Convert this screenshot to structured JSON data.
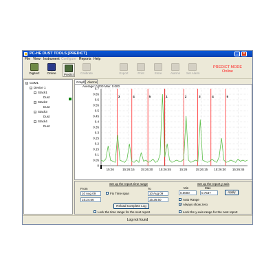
{
  "window": {
    "title": "PC-HE DUST TOOLS [PREDICT]"
  },
  "menu": [
    "File",
    "View",
    "Instrument",
    "Configure",
    "Reports",
    "Help"
  ],
  "toolbar": {
    "buttons": [
      {
        "label": "Digitect",
        "icon": "digitect-icon",
        "enabled": true,
        "color": "#6f8a44"
      },
      {
        "label": "Online",
        "icon": "online-icon",
        "enabled": true,
        "color": "#2a3a8a"
      },
      {
        "label": "Predict",
        "icon": "predict-icon",
        "enabled": true,
        "color": "#4a6a3a"
      },
      {
        "label": "Calibrate",
        "icon": "calibrate-icon",
        "enabled": false
      },
      {
        "label": "Export",
        "icon": "export-icon",
        "enabled": false
      },
      {
        "label": "Print",
        "icon": "print-icon",
        "enabled": false
      },
      {
        "label": "Store",
        "icon": "store-icon",
        "enabled": false
      },
      {
        "label": "Alarms",
        "icon": "alarms-icon",
        "enabled": false
      },
      {
        "label": "Set Alarm",
        "icon": "set-alarm-icon",
        "enabled": false
      }
    ],
    "mode_line1": "PREDICT MODE",
    "mode_line2": "Online"
  },
  "tree": {
    "items": [
      {
        "label": "COM1",
        "level": 0
      },
      {
        "label": "Device 1",
        "level": 1
      },
      {
        "label": "Stack1",
        "level": 2
      },
      {
        "label": "Dust",
        "level": 3
      },
      {
        "label": "Stack2",
        "level": 2
      },
      {
        "label": "Dust",
        "level": 3
      },
      {
        "label": "Stack3",
        "level": 2
      },
      {
        "label": "Dust",
        "level": 3
      },
      {
        "label": "Stack4",
        "level": 2
      },
      {
        "label": "Dust",
        "level": 3
      }
    ]
  },
  "tabs": [
    "Graph",
    "Alarms"
  ],
  "stats": "Average: 0.000   Max: 0.000",
  "chart_data": {
    "type": "line",
    "y_ticks": [
      "0.7",
      "0.65",
      "0.6",
      "0.55",
      "0.5",
      "0.45",
      "0.4",
      "0.35",
      "0.3",
      "0.25",
      "0.2",
      "0.15",
      "0.1",
      "0.05",
      "0"
    ],
    "x_ticks": [
      "15:26",
      "15:26:15",
      "15:26:30",
      "15:26:45",
      "15:26",
      "15:26:15",
      "15:26:30",
      "15:26:45"
    ],
    "ylim": [
      0,
      0.7
    ],
    "grid": true,
    "series": [
      {
        "color": "#5cbf4a",
        "values": [
          0.05,
          0.04,
          0.06,
          0.18,
          0.05,
          0.04,
          0.03,
          0.28,
          0.05,
          0.04,
          0.03,
          0.06,
          0.2,
          0.04,
          0.03,
          0.05,
          0.03,
          0.12,
          0.04,
          0.05,
          0.03,
          0.04,
          0.06,
          0.03,
          0.04,
          0.1,
          0.65,
          0.08,
          0.2,
          0.05,
          0.03,
          0.04,
          0.05,
          0.04,
          0.04,
          0.06,
          0.45,
          0.05,
          0.03,
          0.04,
          0.05,
          0.04,
          0.42,
          0.05,
          0.04,
          0.03,
          0.04,
          0.06,
          0.04,
          0.03,
          0.08,
          0.25,
          0.05,
          0.03,
          0.04,
          0.05,
          0.04,
          0.03,
          0.06,
          0.04,
          0.05,
          0.04,
          0.05
        ]
      }
    ],
    "events": [
      {
        "label": "3",
        "pos": 0.11,
        "color": "#ff4040"
      },
      {
        "label": "4",
        "pos": 0.21,
        "color": "#ff4040"
      },
      {
        "label": "5",
        "pos": 0.32,
        "color": "#ff4040"
      },
      {
        "label": "1",
        "pos": 0.435,
        "color": "#e00000"
      },
      {
        "label": "2",
        "pos": 0.565,
        "color": "#ff4040"
      },
      {
        "label": "3",
        "pos": 0.66,
        "color": "#ff4040"
      },
      {
        "label": "4",
        "pos": 0.75,
        "color": "#ff4040"
      },
      {
        "label": "5",
        "pos": 0.85,
        "color": "#ff4040"
      }
    ]
  },
  "timerange": {
    "heading": "Set up the report time range",
    "from_label": "From",
    "from_date": "10 Aug 09",
    "from_time": "15:24:56",
    "to_label": "To",
    "to_date": "10 Aug 09",
    "to_time": "15:26:50",
    "fix_label": "Fix Time span",
    "reload_label": "Reload Complete Log",
    "lock_label": "Lock the time range for the next report"
  },
  "yaxis": {
    "heading": "Set up the report y-axis",
    "min_label": "Min",
    "max_label": "Max",
    "min_value": "0.0000",
    "max_value": "0.7537",
    "apply_label": "Apply",
    "auto_label": "Auto Range",
    "zero_label": "Always show zero",
    "lock_label": "Lock the  y-axis range for the next report"
  },
  "status": "Log not found"
}
